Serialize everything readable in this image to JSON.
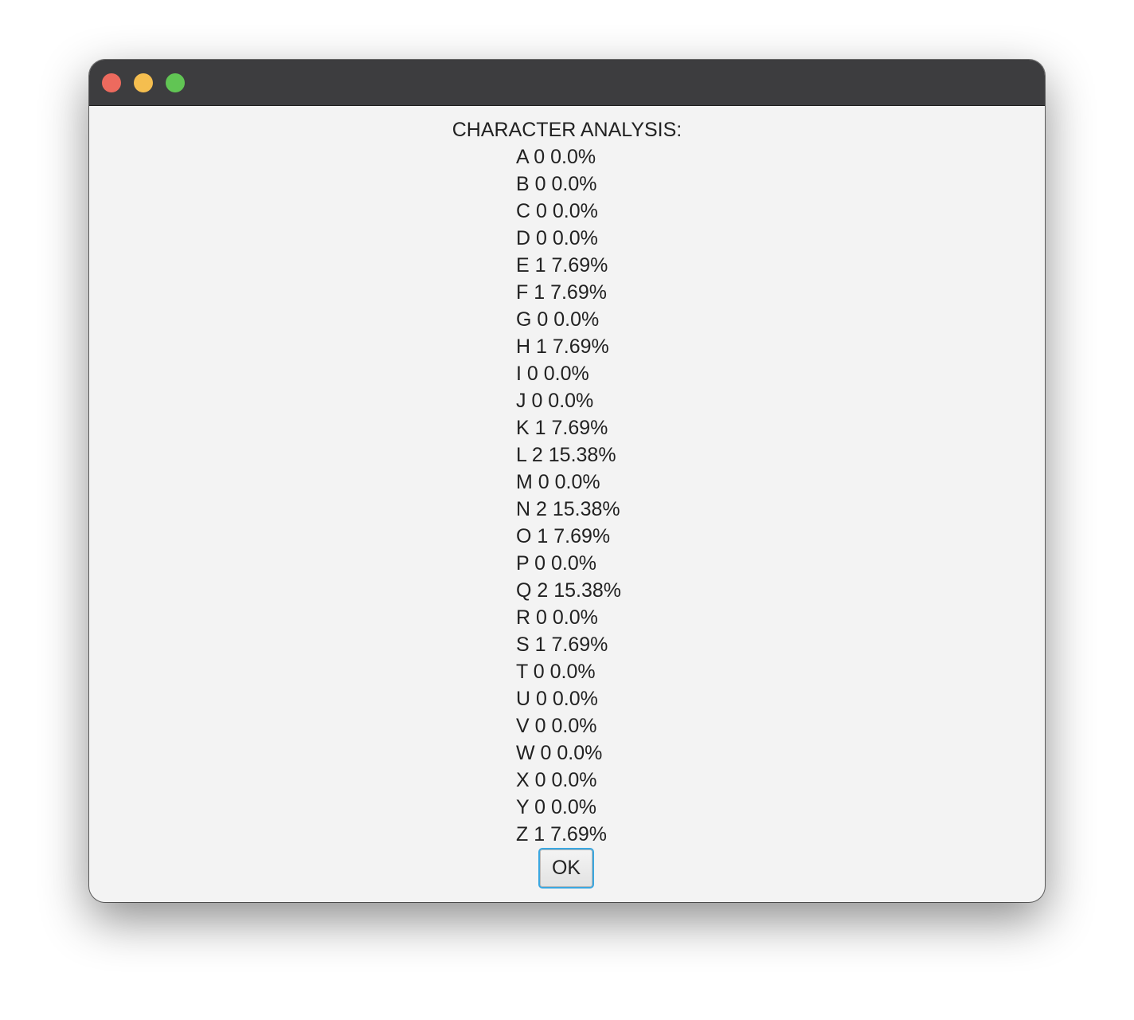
{
  "window": {
    "heading": "CHARACTER ANALYSIS:",
    "traffic_lights": {
      "close_color": "#ed6a5e",
      "minimize_color": "#f5be4f",
      "zoom_color": "#61c554"
    },
    "rows": [
      "A 0 0.0%",
      "B 0 0.0%",
      "C 0 0.0%",
      "D 0 0.0%",
      "E 1 7.69%",
      "F 1 7.69%",
      "G 0 0.0%",
      "H 1 7.69%",
      "I 0 0.0%",
      "J 0 0.0%",
      "K 1 7.69%",
      "L 2 15.38%",
      "M 0 0.0%",
      "N 2 15.38%",
      "O 1 7.69%",
      "P 0 0.0%",
      "Q 2 15.38%",
      "R 0 0.0%",
      "S 1 7.69%",
      "T 0 0.0%",
      "U 0 0.0%",
      "V 0 0.0%",
      "W 0 0.0%",
      "X 0 0.0%",
      "Y 0 0.0%",
      "Z 1 7.69%"
    ],
    "ok_label": "OK",
    "ok_focus_color": "#3ba7e0"
  }
}
